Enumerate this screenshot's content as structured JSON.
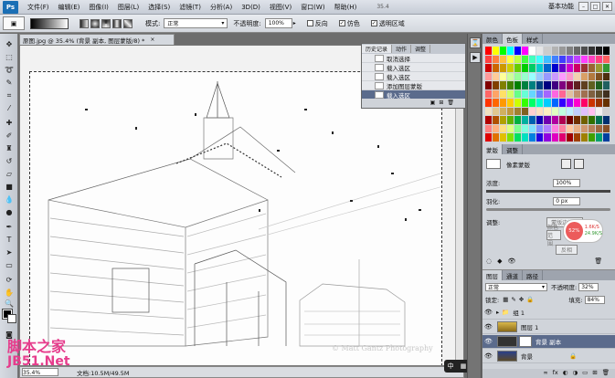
{
  "menubar": {
    "logo": "Ps",
    "items": [
      "文件(F)",
      "编辑(E)",
      "图像(I)",
      "图层(L)",
      "选择(S)",
      "滤镜(T)",
      "分析(A)",
      "3D(D)",
      "视图(V)",
      "窗口(W)",
      "帮助(H)"
    ],
    "zoom": "35.4",
    "workspace": "基本功能",
    "window_controls": [
      "–",
      "□",
      "✕"
    ]
  },
  "options": {
    "mode_label": "模式:",
    "mode_value": "正常",
    "opacity_label": "不透明度:",
    "opacity_value": "100%",
    "reverse_label": "反向",
    "dither_label": "仿色",
    "transparency_label": "透明区域",
    "dither_checked": "✓",
    "transparency_checked": "✓"
  },
  "document": {
    "tab_title": "原图.jpg @ 35.4% (背景 副本, 图层蒙版/8) *",
    "close": "×",
    "photo_watermark": "© Matt Gantz Photography",
    "status_zoom": "35.4%",
    "status_doc": "文档:10.5M/49.5M"
  },
  "history": {
    "tabs": [
      "历史记录",
      "动作",
      "调整"
    ],
    "items": [
      "取消选择",
      "载入选区",
      "载入选区",
      "添加图层蒙版",
      "载入选区"
    ],
    "active_index": 4
  },
  "swatches": {
    "tabs": [
      "颜色",
      "色板",
      "样式"
    ],
    "colors": [
      "#ff0000",
      "#ffff00",
      "#00ff00",
      "#00ffff",
      "#0000ff",
      "#ff00ff",
      "#ffffff",
      "#e6e6e6",
      "#cccccc",
      "#b3b3b3",
      "#999999",
      "#808080",
      "#666666",
      "#4d4d4d",
      "#333333",
      "#1a1a1a",
      "#000000",
      "#ff4040",
      "#ff8040",
      "#ffbf40",
      "#ffff40",
      "#bfff40",
      "#40ff40",
      "#40ffbf",
      "#40ffff",
      "#40bfff",
      "#4080ff",
      "#4040ff",
      "#8040ff",
      "#bf40ff",
      "#ff40ff",
      "#ff40bf",
      "#ff4080",
      "#ff6060",
      "#cc0000",
      "#cc6600",
      "#cc9900",
      "#cccc00",
      "#66cc00",
      "#00cc00",
      "#00cc66",
      "#00cccc",
      "#0066cc",
      "#0000cc",
      "#6600cc",
      "#cc00cc",
      "#cc0066",
      "#993333",
      "#996633",
      "#999933",
      "#339933",
      "#ff9999",
      "#ffcc99",
      "#ffff99",
      "#ccff99",
      "#99ff99",
      "#99ffcc",
      "#99ffff",
      "#99ccff",
      "#9999ff",
      "#cc99ff",
      "#ff99ff",
      "#ff99cc",
      "#f2d0b0",
      "#d9a066",
      "#b37a3f",
      "#805020",
      "#4d3010",
      "#800000",
      "#804000",
      "#808000",
      "#408000",
      "#008000",
      "#008040",
      "#008080",
      "#004080",
      "#000080",
      "#400080",
      "#800080",
      "#800040",
      "#602020",
      "#604020",
      "#606020",
      "#206020",
      "#206060",
      "#ff6666",
      "#ffa366",
      "#ffe066",
      "#d1ff66",
      "#66ff85",
      "#66ffd6",
      "#66d6ff",
      "#6685ff",
      "#a366ff",
      "#ff66e0",
      "#ff6694",
      "#e0c0a0",
      "#c09070",
      "#a07050",
      "#806040",
      "#605030",
      "#403020",
      "#ff3300",
      "#ff6600",
      "#ff9900",
      "#ffcc00",
      "#ccff00",
      "#33ff00",
      "#00ff66",
      "#00ffcc",
      "#00ccff",
      "#0066ff",
      "#3300ff",
      "#9900ff",
      "#ff00cc",
      "#ff0066",
      "#cc3300",
      "#993300",
      "#663300",
      "#f0e0c0",
      "#e0c890",
      "#d0b060",
      "#c09840",
      "#a08030",
      "#806020",
      "#ffd0d0",
      "#ffe0c0",
      "#fff0c0",
      "#e0ffc0",
      "#c0ffe0",
      "#c0f0ff",
      "#c0d0ff",
      "#e0c0ff",
      "#ffc0f0",
      "#f0f0f0",
      "#d0d0d0",
      "#b00000",
      "#b05000",
      "#b0a000",
      "#60b000",
      "#00b040",
      "#00b0a0",
      "#0060b0",
      "#1000b0",
      "#7000b0",
      "#b000a0",
      "#b00050",
      "#700000",
      "#703000",
      "#706000",
      "#307000",
      "#007050",
      "#003070",
      "#ff8080",
      "#ffb080",
      "#ffe080",
      "#e0ff80",
      "#80ff90",
      "#80ffe0",
      "#80e0ff",
      "#8090ff",
      "#b080ff",
      "#ff80e0",
      "#ff80a0",
      "#ffc8a0",
      "#e8b088",
      "#d09870",
      "#b88058",
      "#a06840",
      "#885028",
      "#e00000",
      "#e07000",
      "#e0c000",
      "#80e000",
      "#00e060",
      "#00e0c0",
      "#0080e0",
      "#2000e0",
      "#9000e0",
      "#e000c0",
      "#e00070",
      "#a00000",
      "#a04000",
      "#a08000",
      "#40a000",
      "#00a070",
      "#0040a0"
    ]
  },
  "masks": {
    "tabs": [
      "蒙版",
      "调整"
    ],
    "mask_type": "像素蒙版",
    "density_label": "浓度:",
    "density_value": "100%",
    "density_fill": 1.0,
    "feather_label": "羽化:",
    "feather_value": "0 px",
    "feather_fill": 0.0,
    "adjust_label": "调整:",
    "mask_edge_btn": "蒙版边缘...",
    "color_range_btn": "颜色范围...",
    "invert_btn": "反相",
    "net_pct": "52%",
    "net_up": "1.6K/S",
    "net_down": "24.9K/S"
  },
  "layers": {
    "tabs": [
      "图层",
      "通道",
      "路径"
    ],
    "blend_mode": "正常",
    "opacity_label": "不透明度:",
    "opacity_value": "32%",
    "lock_label": "锁定:",
    "fill_label": "填充:",
    "fill_value": "84%",
    "rows": [
      {
        "name": "组 1",
        "active": false
      },
      {
        "name": "图层 1",
        "active": false
      },
      {
        "name": "背景 副本",
        "active": true
      },
      {
        "name": "背景",
        "active": false
      }
    ],
    "footer_icons": [
      "∞",
      "fx",
      "◐",
      "◑",
      "▭",
      "⊞",
      "🗑"
    ]
  },
  "ime": {
    "label": "中",
    "icon": "▦"
  },
  "site_watermark": {
    "line1": "脚本之家",
    "line2": "JB51.Net"
  }
}
